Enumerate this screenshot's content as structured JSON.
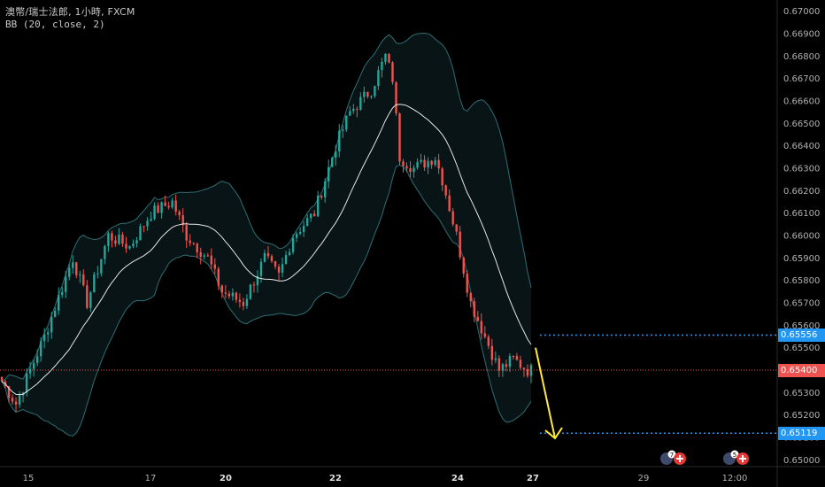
{
  "header": {
    "title": "澳幣/瑞士法郎, 1小時, FXCM",
    "indicator": "BB (20, close, 2)"
  },
  "colors": {
    "background": "#000000",
    "up": "#26a69a",
    "down": "#ef5350",
    "bands": "#2e6f75",
    "basis": "#e8e8e8",
    "arrow": "#ffeb3b",
    "last_price": "#ef5350",
    "levels": "#2196f3"
  },
  "price_tags": {
    "upper_level": "0.65556",
    "last_price": "0.65400",
    "lower_level": "0.65119"
  },
  "event_badges": [
    {
      "icon": "economic-event-icon",
      "count": "7"
    },
    {
      "icon": "economic-event-icon",
      "count": "5"
    }
  ],
  "chart_data": {
    "type": "candlestick",
    "y_axis_ticks": [
      "0.67000",
      "0.66900",
      "0.66800",
      "0.66700",
      "0.66600",
      "0.66500",
      "0.66400",
      "0.66300",
      "0.66200",
      "0.66100",
      "0.66000",
      "0.65900",
      "0.65800",
      "0.65700",
      "0.65600",
      "0.65500",
      "0.65400",
      "0.65300",
      "0.65200",
      "0.65100",
      "0.65000"
    ],
    "ylim": [
      0.6497,
      0.6705
    ],
    "x_axis_ticks": [
      "15",
      "17",
      "20",
      "22",
      "24",
      "27",
      "29",
      "12:00"
    ],
    "x_tick_bold": [
      "20",
      "22",
      "24",
      "27"
    ],
    "bars": 150,
    "series": [
      {
        "name": "close",
        "anchors": [
          [
            0,
            0.6535
          ],
          [
            4,
            0.6525
          ],
          [
            12,
            0.6555
          ],
          [
            20,
            0.659
          ],
          [
            24,
            0.657
          ],
          [
            30,
            0.66
          ],
          [
            36,
            0.6595
          ],
          [
            42,
            0.661
          ],
          [
            48,
            0.6615
          ],
          [
            52,
            0.66
          ],
          [
            58,
            0.659
          ],
          [
            62,
            0.6575
          ],
          [
            68,
            0.657
          ],
          [
            74,
            0.659
          ],
          [
            78,
            0.6582
          ],
          [
            82,
            0.66
          ],
          [
            88,
            0.661
          ],
          [
            94,
            0.664
          ],
          [
            98,
            0.6655
          ],
          [
            104,
            0.6665
          ],
          [
            108,
            0.668
          ],
          [
            110,
            0.667
          ],
          [
            112,
            0.6635
          ],
          [
            116,
            0.663
          ],
          [
            122,
            0.6635
          ],
          [
            124,
            0.6625
          ],
          [
            128,
            0.66
          ],
          [
            132,
            0.657
          ],
          [
            136,
            0.6555
          ],
          [
            140,
            0.654
          ],
          [
            144,
            0.6545
          ],
          [
            148,
            0.654
          ],
          [
            150,
            0.654
          ]
        ]
      }
    ],
    "annotations": {
      "horizontal_levels": [
        0.65556,
        0.65119
      ],
      "last_price": 0.654,
      "projection_arrow": {
        "from": 0.655,
        "to": 0.6512
      }
    }
  }
}
